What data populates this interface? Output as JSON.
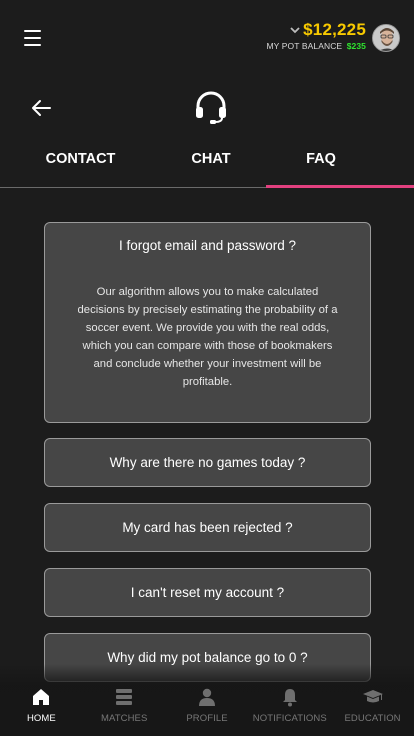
{
  "header": {
    "balance_amount": "$12,225",
    "pot_label": "MY POT BALANCE",
    "pot_value": "$235"
  },
  "tabs": [
    {
      "label": "CONTACT"
    },
    {
      "label": "CHAT"
    },
    {
      "label": "FAQ"
    }
  ],
  "faq": {
    "expanded": {
      "question": "I forgot email and password ?",
      "answer": "Our algorithm allows you to make calculated decisions by precisely estimating the probability of a soccer event. We provide you with the real odds, which you can compare with those of bookmakers and conclude whether your investment will be profitable."
    },
    "items": [
      {
        "question": "Why are there no games today ?"
      },
      {
        "question": "My card has been rejected ?"
      },
      {
        "question": "I can't reset my account ?"
      },
      {
        "question": "Why did my pot balance go to 0 ?"
      }
    ]
  },
  "bottom_nav": {
    "active": "home",
    "items": [
      {
        "label": "HOME",
        "icon": "home-icon"
      },
      {
        "label": "MATCHES",
        "icon": "matches-icon"
      },
      {
        "label": "PROFILE",
        "icon": "profile-icon"
      },
      {
        "label": "NOTIFICATIONS",
        "icon": "bell-icon"
      },
      {
        "label": "EDUCATION",
        "icon": "graduation-cap-icon"
      }
    ]
  },
  "colors": {
    "accent_tab": "#e2407f",
    "balance": "#f7c900",
    "pot_value": "#2ee52e",
    "card_bg": "#464646"
  }
}
